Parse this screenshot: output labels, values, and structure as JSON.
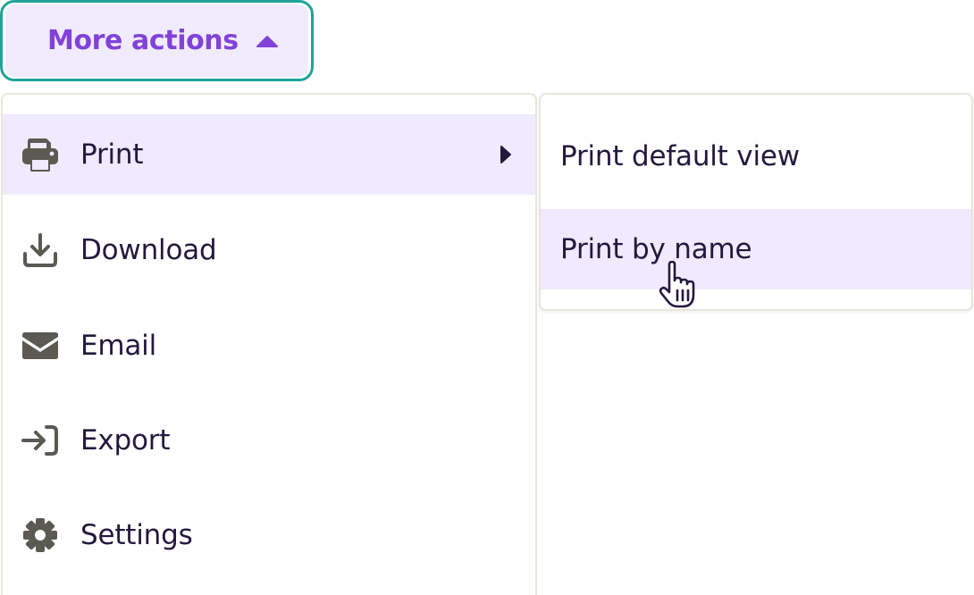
{
  "trigger": {
    "label": "More actions",
    "caret_icon": "caret-up-icon",
    "label_color": "#8242d8",
    "background": "#f0ebfd",
    "focus_ring_color": "#1fa39a"
  },
  "menu": {
    "items": [
      {
        "label": "Print",
        "icon": "printer-icon",
        "active": true,
        "has_submenu": true
      },
      {
        "label": "Download",
        "icon": "download-icon"
      },
      {
        "label": "Email",
        "icon": "envelope-icon"
      },
      {
        "label": "Export",
        "icon": "sign-in-icon"
      },
      {
        "label": "Settings",
        "icon": "gear-icon"
      }
    ],
    "highlight_color": "#efeafd",
    "text_color": "#24183e",
    "icon_color": "#5b5a52"
  },
  "submenu": {
    "items": [
      {
        "label": "Print default view"
      },
      {
        "label": "Print by name",
        "hovered": true
      }
    ]
  },
  "pointer": {
    "icon": "hand-pointer-cursor-icon"
  }
}
